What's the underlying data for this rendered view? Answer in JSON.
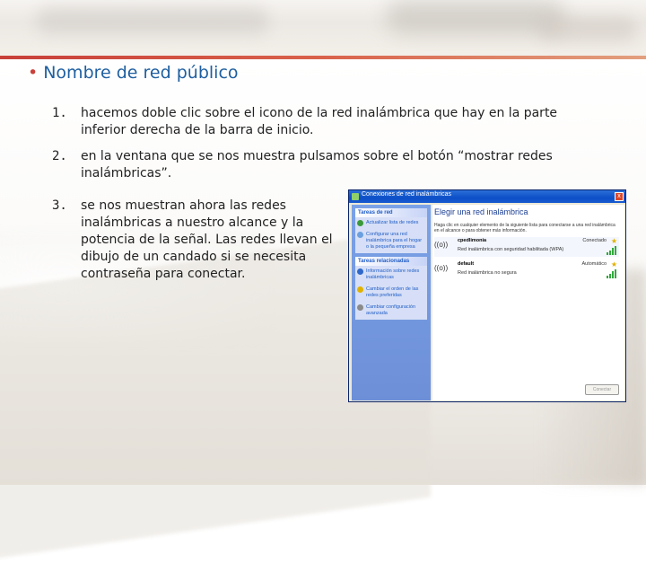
{
  "heading": {
    "bullet": "•",
    "text": "Nombre de red público"
  },
  "items": [
    {
      "num": "1.",
      "text": "hacemos doble clic sobre el icono de la red inalámbrica que hay en la parte inferior derecha de la barra de inicio."
    },
    {
      "num": "2.",
      "text": " en la ventana que se nos muestra pulsamos sobre el botón “mostrar redes inalámbricas”."
    },
    {
      "num": "3.",
      "text": "se nos muestran ahora las redes inalámbricas a nuestro alcance y la potencia de la señal. Las redes llevan el dibujo de un candado si se necesita contraseña para conectar."
    }
  ],
  "window": {
    "title": "Conexiones de red inalámbricas",
    "close_label": "x",
    "panel_tasks": {
      "header": "Tareas de red",
      "items": [
        "Actualizar lista de redes",
        "Configurar una red inalámbrica para el hogar o la pequeña empresa"
      ]
    },
    "panel_related": {
      "header": "Tareas relacionadas",
      "items": [
        "Información sobre redes inalámbricas",
        "Cambiar el orden de las redes preferidas",
        "Cambiar configuración avanzada"
      ]
    },
    "content_title": "Elegir una red inalámbrica",
    "content_desc": "Haga clic en cualquier elemento de la siguiente lista para conectarse a una red inalámbrica en el alcance o para obtener más información.",
    "networks": [
      {
        "signal": "((o))",
        "name": "cpedlimonia",
        "status": "Conectado",
        "sub": "Red inalámbrica con seguridad habilitada (WPA)"
      },
      {
        "signal": "((o))",
        "name": "default",
        "status": "Automático",
        "sub": "Red inalámbrica no segura"
      }
    ],
    "connect_label": "Conectar"
  }
}
